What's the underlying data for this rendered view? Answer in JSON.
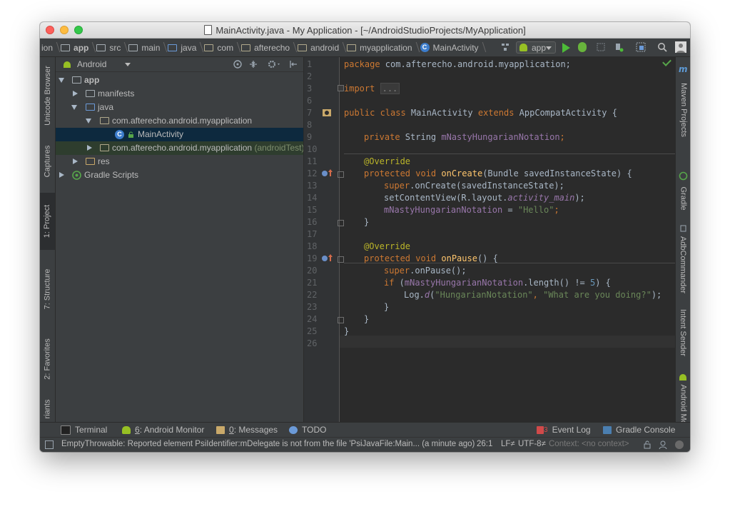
{
  "window": {
    "title": "MainActivity.java - My Application - [~/AndroidStudioProjects/MyApplication]"
  },
  "navbar": {
    "crumbs": [
      "ion",
      "app",
      "src",
      "main",
      "java",
      "com",
      "afterecho",
      "android",
      "myapplication",
      "MainActivity"
    ],
    "run_config": "app"
  },
  "left_tools": {
    "unicode_browser": "Unicode Browser",
    "captures": "Captures",
    "project": "1: Project",
    "structure": "7: Structure",
    "favorites": "2: Favorites",
    "variants": "riants"
  },
  "right_tools": {
    "maven": "Maven Projects",
    "gradle": "Gradle",
    "adb": "AdbCommander",
    "intent": "Intent Sender",
    "android_model": "Android Model"
  },
  "project": {
    "view_selector": "Android",
    "tree": [
      {
        "label": "app",
        "bold": true
      },
      {
        "label": "manifests"
      },
      {
        "label": "java"
      },
      {
        "label": "com.afterecho.android.myapplication"
      },
      {
        "label": "MainActivity"
      },
      {
        "label": "com.afterecho.android.myapplication",
        "suffix": "(androidTest)"
      },
      {
        "label": "res"
      },
      {
        "label": "Gradle Scripts"
      }
    ]
  },
  "editor": {
    "line_numbers": [
      "1",
      "2",
      "3",
      "6",
      "7",
      "8",
      "9",
      "10",
      "11",
      "12",
      "13",
      "14",
      "15",
      "16",
      "17",
      "18",
      "19",
      "20",
      "21",
      "22",
      "23",
      "24",
      "25",
      "26"
    ],
    "code": {
      "l1_kw": "package",
      "l1_rest": " com.afterecho.android.myapplication;",
      "l3_kw": "import",
      "l3_fold": "...",
      "l7_kw1": "public class",
      "l7_name": " MainActivity ",
      "l7_kw2": "extends",
      "l7_rest": " AppCompatActivity {",
      "l9_kw": "private",
      "l9_type": " String ",
      "l9_field": "mNastyHungarianNotation",
      "l9_end": ";",
      "l11": "@Override",
      "l12_kw": "protected void",
      "l12_fn": " onCreate",
      "l12_rest": "(Bundle savedInstanceState) {",
      "l13_kw": "super",
      "l13_rest": ".onCreate(savedInstanceState);",
      "l14_a": "setContentView(R.layout.",
      "l14_it": "activity_main",
      "l14_b": ");",
      "l15_field": "mNastyHungarianNotation",
      "l15_eq": " = ",
      "l15_str": "\"Hello\"",
      "l15_end": ";",
      "l16": "}",
      "l18": "@Override",
      "l19_kw": "protected void",
      "l19_fn": " onPause",
      "l19_rest": "() {",
      "l20_kw": "super",
      "l20_rest": ".onPause();",
      "l21_kw": "if",
      "l21_a": " (",
      "l21_field": "mNastyHungarianNotation",
      "l21_b": ".length() != ",
      "l21_num": "5",
      "l21_c": ") {",
      "l22_a": "Log.",
      "l22_it": "d",
      "l22_b": "(",
      "l22_s1": "\"HungarianNotation\"",
      "l22_c": ", ",
      "l22_s2": "\"What are you doing?\"",
      "l22_d": ");",
      "l23": "}",
      "l24": "}",
      "l25": "}"
    }
  },
  "bottom_tabs": {
    "terminal": "Terminal",
    "android_monitor_num": "6",
    "android_monitor": ": Android Monitor",
    "messages_num": "0",
    "messages": ": Messages",
    "todo": "TODO",
    "event_log_count": "3",
    "event_log": "Event Log",
    "gradle_console": "Gradle Console"
  },
  "status": {
    "message": "EmptyThrowable: Reported element PsiIdentifier:mDelegate is not from the file 'PsiJavaFile:Main... (a minute ago)",
    "position": "26:1",
    "line_sep": "LF≠",
    "encoding": "UTF-8≠",
    "context": "Context: <no context>"
  },
  "colors": {
    "editor_bg": "#2b2b2b",
    "panel_bg": "#3c3f41",
    "selection": "#0d293e",
    "keyword": "#cc7832",
    "string": "#6a8759",
    "field": "#9876aa",
    "function": "#ffc66d"
  }
}
